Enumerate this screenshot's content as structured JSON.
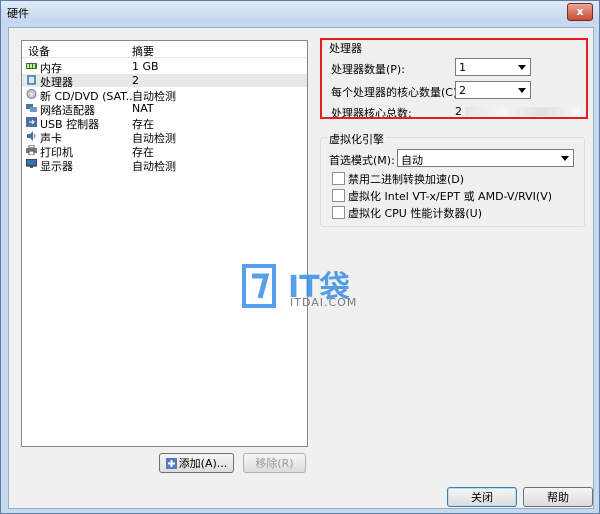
{
  "window": {
    "title": "硬件",
    "close_glyph": "x"
  },
  "list": {
    "headers": {
      "device": "设备",
      "summary": "摘要"
    },
    "rows": [
      {
        "name": "内存",
        "value": "1 GB"
      },
      {
        "name": "处理器",
        "value": "2"
      },
      {
        "name": "新 CD/DVD (SAT...",
        "value": "自动检测"
      },
      {
        "name": "网络适配器",
        "value": "NAT"
      },
      {
        "name": "USB 控制器",
        "value": "存在"
      },
      {
        "name": "声卡",
        "value": "自动检测"
      },
      {
        "name": "打印机",
        "value": "存在"
      },
      {
        "name": "显示器",
        "value": "自动检测"
      }
    ]
  },
  "buttons": {
    "add": "添加(A)...",
    "remove": "移除(R)",
    "close": "关闭",
    "help": "帮助"
  },
  "processor": {
    "title": "处理器",
    "count_label": "处理器数量(P):",
    "count_value": "1",
    "cores_label": "每个处理器的核心数量(C):",
    "cores_value": "2",
    "total_label": "处理器核心总数:",
    "total_value": "2"
  },
  "virtualization": {
    "title": "虚拟化引擎",
    "mode_label": "首选模式(M):",
    "mode_value": "自动",
    "options": [
      "禁用二进制转换加速(D)",
      "虚拟化 Intel VT-x/EPT 或 AMD-V/RVI(V)",
      "虚拟化 CPU 性能计数器(U)"
    ]
  },
  "watermark": {
    "brand": "IT袋",
    "domain": "ITDAI.COM"
  },
  "colors": {
    "highlight": "#e01e24",
    "watermark": "#3a8ee6"
  }
}
